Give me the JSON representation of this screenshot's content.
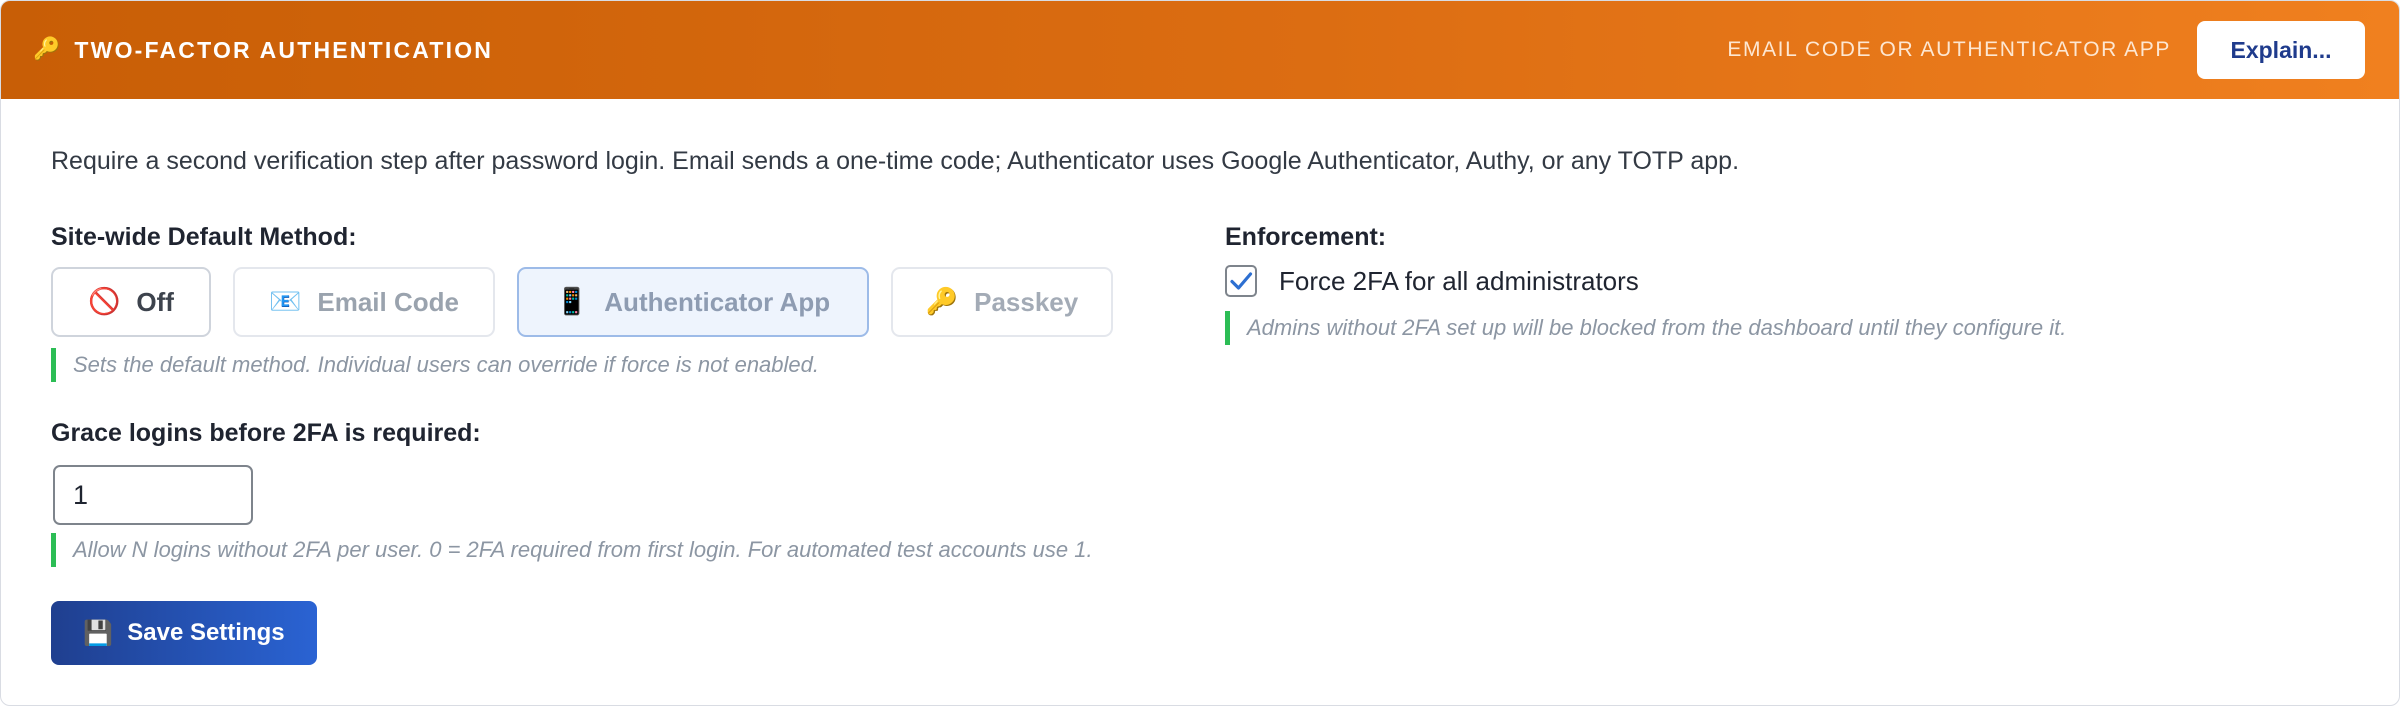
{
  "header": {
    "icon": "key-icon",
    "title": "TWO-FACTOR AUTHENTICATION",
    "subtitle": "EMAIL CODE OR AUTHENTICATOR APP",
    "explain_label": "Explain..."
  },
  "description": "Require a second verification step after password login. Email sends a one-time code; Authenticator uses Google Authenticator, Authy, or any TOTP app.",
  "default_method": {
    "label": "Site-wide Default Method:",
    "options": [
      {
        "icon": "no-entry-icon",
        "glyph": "🚫",
        "label": "Off"
      },
      {
        "icon": "email-icon",
        "glyph": "📧",
        "label": "Email Code"
      },
      {
        "icon": "phone-icon",
        "glyph": "📱",
        "label": "Authenticator App"
      },
      {
        "icon": "key-icon",
        "glyph": "🔑",
        "label": "Passkey"
      }
    ],
    "selected": "Authenticator App",
    "hint": "Sets the default method. Individual users can override if force is not enabled."
  },
  "grace": {
    "label": "Grace logins before 2FA is required:",
    "value": "1",
    "hint": "Allow N logins without 2FA per user. 0 = 2FA required from first login. For automated test accounts use 1."
  },
  "save_label": "Save Settings",
  "enforcement": {
    "label": "Enforcement:",
    "checkbox_label": "Force 2FA for all administrators",
    "checked": true,
    "hint": "Admins without 2FA set up will be blocked from the dashboard until they configure it."
  },
  "colors": {
    "header_start": "#c85e06",
    "header_end": "#f0801f",
    "hint_bar": "#2cbd55",
    "save_button": "#2a63d3"
  }
}
